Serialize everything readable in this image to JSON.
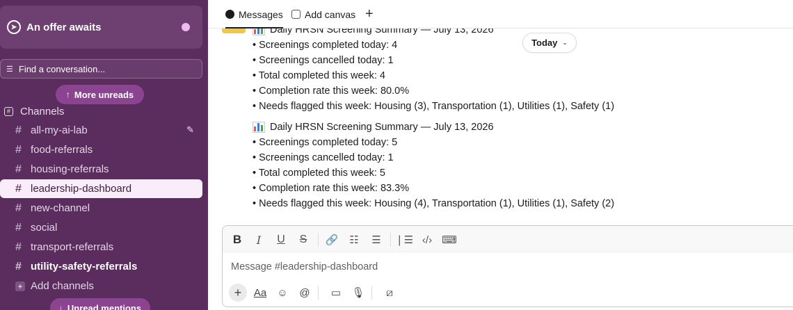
{
  "sidebar": {
    "offer_label": "An offer awaits",
    "search_label": "Find a conversation...",
    "more_unreads_label": "More unreads",
    "unread_mentions_label": "Unread mentions",
    "channels_header": "Channels",
    "channels": [
      {
        "name": "all-my-ai-lab"
      },
      {
        "name": "food-referrals"
      },
      {
        "name": "housing-referrals"
      },
      {
        "name": "leadership-dashboard"
      },
      {
        "name": "new-channel"
      },
      {
        "name": "social"
      },
      {
        "name": "transport-referrals"
      },
      {
        "name": "utility-safety-referrals"
      }
    ],
    "add_channels_label": "Add channels"
  },
  "header": {
    "tabs": [
      {
        "label": "Messages"
      },
      {
        "label": "Add canvas"
      }
    ]
  },
  "messages": {
    "today_label": "Today",
    "items": [
      {
        "title": "Daily HRSN Screening Summary — July 13, 2026",
        "bullets": [
          "Screenings completed today: 4",
          "Screenings cancelled today: 1",
          "Total completed this week: 4",
          "Completion rate this week: 80.0%",
          "Needs flagged this week: Housing (3), Transportation (1), Utilities (1), Safety (1)"
        ]
      },
      {
        "title": "Daily HRSN Screening Summary — July 13, 2026",
        "bullets": [
          "Screenings completed today: 5",
          "Screenings cancelled today: 1",
          "Total completed this week: 5",
          "Completion rate this week: 83.3%",
          "Needs flagged this week: Housing (4), Transportation (1), Utilities (1), Safety (2)"
        ]
      }
    ]
  },
  "composer": {
    "placeholder": "Message #leadership-dashboard",
    "format_label": "Aa"
  },
  "colors": {
    "sidebar_bg": "#5b2c5e",
    "active_channel_bg": "#f9edfa",
    "pill_bg": "#8b4490"
  }
}
